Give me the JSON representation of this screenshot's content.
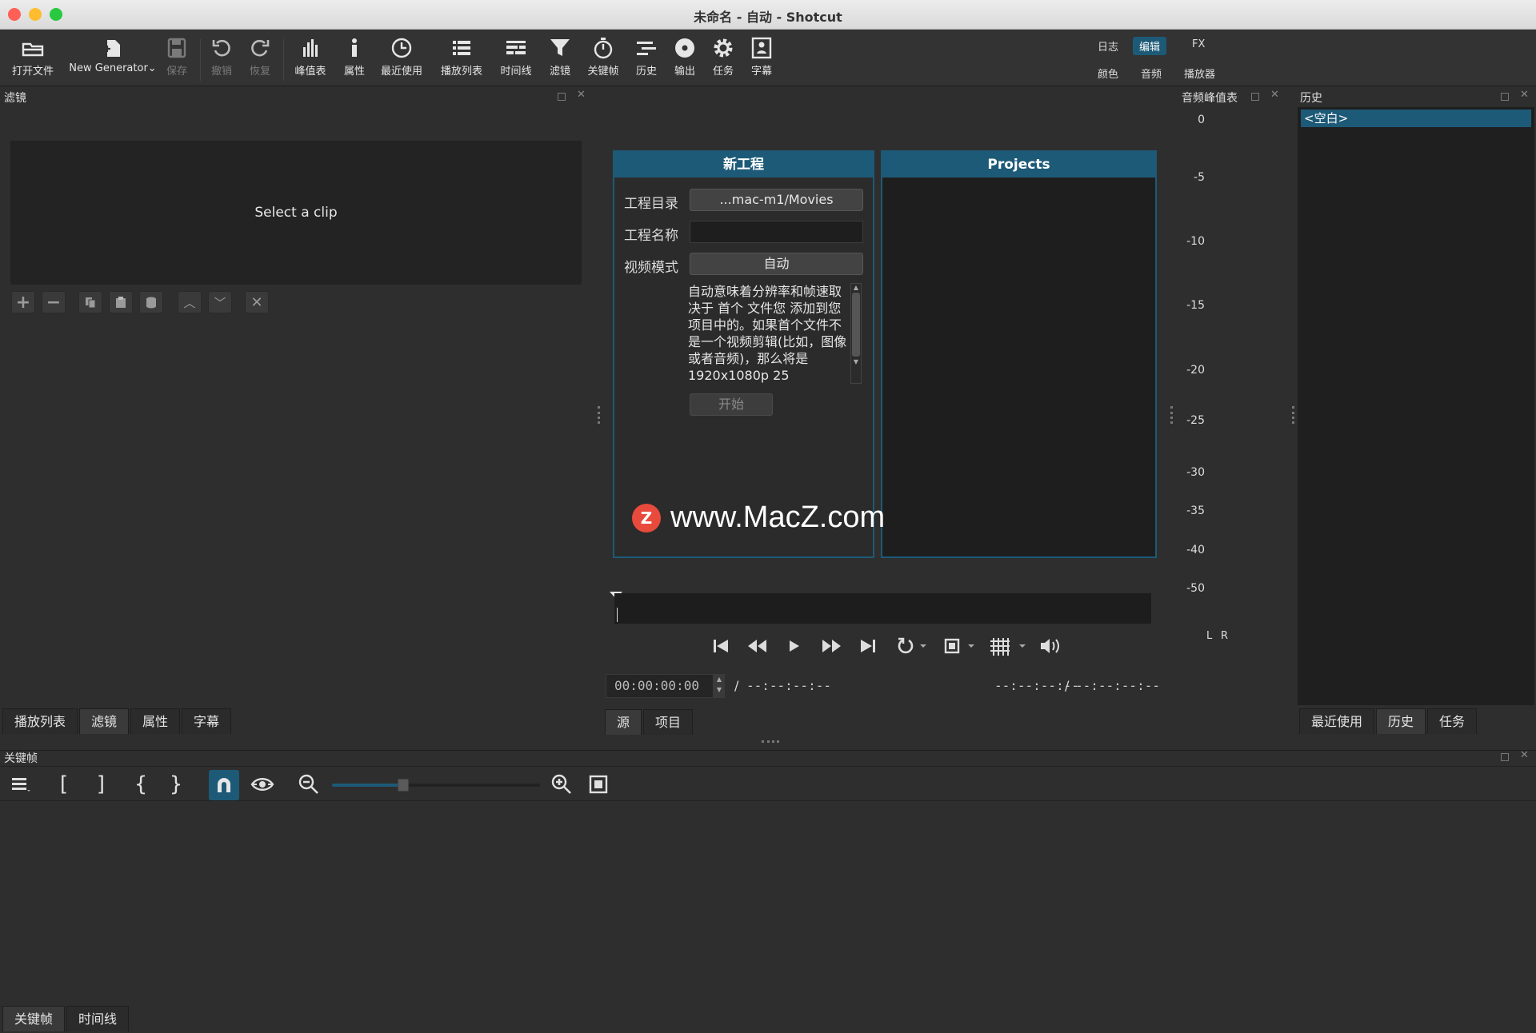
{
  "window": {
    "title": "未命名 - 自动 - Shotcut"
  },
  "toolbar": {
    "open": "打开文件",
    "new_generator": "New Generator",
    "save": "保存",
    "undo": "撤销",
    "redo": "恢复",
    "peak_meter": "峰值表",
    "properties": "属性",
    "recent": "最近使用",
    "playlist": "播放列表",
    "timeline": "时间线",
    "filters": "滤镜",
    "keyframes": "关键帧",
    "history": "历史",
    "export": "输出",
    "jobs": "任务",
    "subtitles": "字幕"
  },
  "layouts": {
    "row1": [
      "日志",
      "编辑",
      "FX"
    ],
    "row2": [
      "颜色",
      "音频",
      "播放器"
    ],
    "active": "编辑"
  },
  "filters_panel": {
    "title": "滤镜",
    "placeholder": "Select a clip"
  },
  "left_tabs": [
    "播放列表",
    "滤镜",
    "属性",
    "字幕"
  ],
  "new_project": {
    "title": "新工程",
    "dir_label": "工程目录",
    "dir_value": "...mac-m1/Movies",
    "name_label": "工程名称",
    "name_value": "",
    "mode_label": "视频模式",
    "mode_value": "自动",
    "description": "自动意味着分辨率和帧速取决于 首个 文件您 添加到您项目中的。如果首个文件不是一个视频剪辑(比如，图像或者音频)，那么将是 1920x1080p 25",
    "start_button": "开始"
  },
  "projects_panel": {
    "title": "Projects"
  },
  "watermark": {
    "text": "www.MacZ.com"
  },
  "player": {
    "timecode": "00:00:00:00",
    "duration": "--:--:--:--",
    "in_point": "--:--:--:--",
    "out_point": "--:--:--:--",
    "slash": "/"
  },
  "center_tabs": [
    "源",
    "项目"
  ],
  "audio_meter": {
    "title": "音频峰值表",
    "ticks": [
      "0",
      "-5",
      "-10",
      "-15",
      "-20",
      "-25",
      "-30",
      "-35",
      "-40",
      "-50"
    ],
    "channels": [
      "L",
      "R"
    ]
  },
  "history_panel": {
    "title": "历史",
    "items": [
      "<空白>"
    ]
  },
  "right_tabs": [
    "最近使用",
    "历史",
    "任务"
  ],
  "keyframes_panel": {
    "title": "关键帧"
  },
  "bottom_tabs": [
    "关键帧",
    "时间线"
  ],
  "colors": {
    "accent": "#1d5a77",
    "panel_header": "#1d5a77",
    "background": "#2e2e2e"
  }
}
